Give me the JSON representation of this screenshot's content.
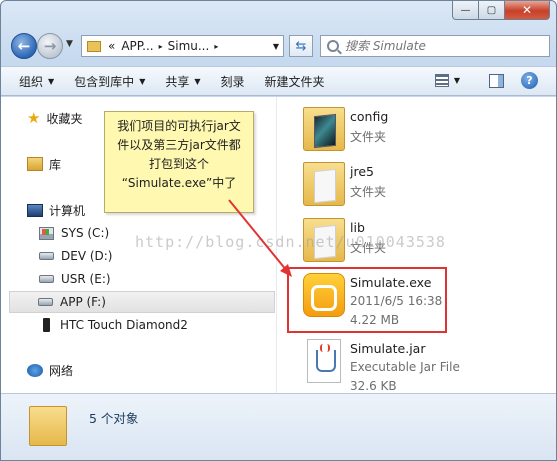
{
  "window": {
    "caption": {
      "minimize": "—",
      "maximize": "▢",
      "close": "✕"
    }
  },
  "address": {
    "prefix": "«",
    "segments": [
      "APP...",
      "Simu..."
    ],
    "separator": "▸",
    "dropdown": "▼"
  },
  "search": {
    "placeholder": "搜索 Simulate"
  },
  "toolbar": {
    "organize": "组织",
    "include_library": "包含到库中",
    "share": "共享",
    "burn": "刻录",
    "new_folder": "新建文件夹",
    "caret": "▼"
  },
  "nav": {
    "favorites": "收藏夹",
    "libraries": "库",
    "computer": "计算机",
    "drives": [
      "SYS (C:)",
      "DEV (D:)",
      "USR (E:)",
      "APP (F:)"
    ],
    "device": "HTC Touch Diamond2",
    "network": "网络"
  },
  "files": [
    {
      "name": "config",
      "type": "文件夹"
    },
    {
      "name": "jre5",
      "type": "文件夹"
    },
    {
      "name": "lib",
      "type": "文件夹"
    },
    {
      "name": "Simulate.exe",
      "date": "2011/6/5 16:38",
      "size": "4.22 MB"
    },
    {
      "name": "Simulate.jar",
      "type": "Executable Jar File",
      "size": "32.6 KB"
    }
  ],
  "callout": {
    "line1": "我们项目的可执行jar文",
    "line2": "件以及第三方jar文件都",
    "line3": "打包到这个",
    "line4": "“Simulate.exe”中了"
  },
  "watermark": "http://blog.csdn.net/u010043538",
  "details": {
    "count": "5 个对象"
  },
  "colors": {
    "highlight": "#e03434",
    "callout_bg": "#fff8b0"
  }
}
